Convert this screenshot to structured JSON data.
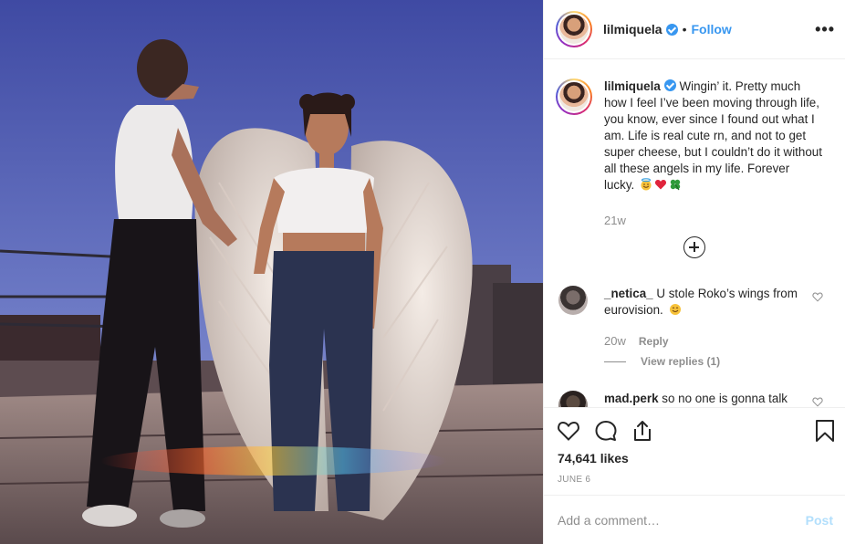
{
  "post": {
    "username": "lilmiquela",
    "follow_label": "Follow",
    "dot": "•",
    "more_label": "•••"
  },
  "caption": {
    "username": "lilmiquela",
    "text": "Wingin’ it. Pretty much how I feel I’ve been moving through life, you know, ever since I found out what I am. Life is real cute rn, and not to get super cheese, but I couldn’t do it without all these angels in my life. Forever lucky.",
    "time": "21w"
  },
  "comments": [
    {
      "username": "_netica_",
      "text": "U stole Roko’s wings from eurovision.",
      "time": "20w",
      "reply_label": "Reply",
      "view_replies_label": "View replies (1)"
    },
    {
      "username": "mad.perk",
      "text": "so no one is gonna talk"
    }
  ],
  "stats": {
    "likes": "74,641 likes",
    "date": "JUNE 6"
  },
  "add_comment": {
    "placeholder": "Add a comment…",
    "post_label": "Post"
  },
  "icons": {
    "like": "heart-icon",
    "comment": "speech-bubble-icon",
    "share": "share-icon",
    "save": "bookmark-icon",
    "more": "more-options-icon",
    "load_more": "plus-circle-icon"
  },
  "colors": {
    "link_blue": "#3897f0",
    "muted": "#8e8e8e",
    "text": "#262626",
    "post_disabled": "#b2dffc",
    "border": "#efefef"
  }
}
